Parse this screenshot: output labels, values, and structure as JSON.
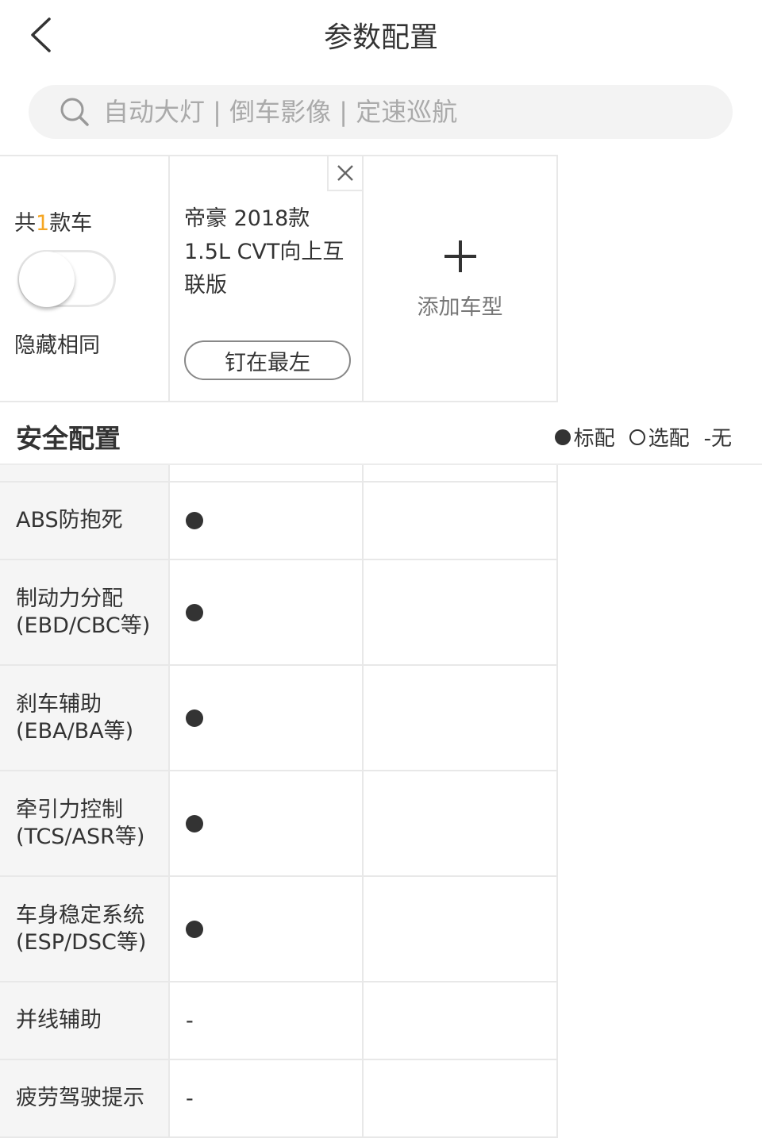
{
  "header": {
    "title": "参数配置"
  },
  "search": {
    "placeholder": "自动大灯 | 倒车影像 | 定速巡航"
  },
  "cars": {
    "count_prefix": "共",
    "count": "1",
    "count_suffix": "款车",
    "hide_same_label": "隐藏相同",
    "hide_same_enabled": false,
    "items": [
      {
        "name": "帝豪 2018款 1.5L CVT向上互联版",
        "pin_label": "钉在最左"
      }
    ],
    "add_label": "添加车型"
  },
  "section": {
    "title": "安全配置",
    "legend": {
      "standard": "标配",
      "optional": "选配",
      "none": "-无"
    }
  },
  "rows": [
    {
      "label": "ABS防抱死",
      "value": "●"
    },
    {
      "label": "制动力分配(EBD/CBC等)",
      "value": "●"
    },
    {
      "label": "刹车辅助(EBA/BA等)",
      "value": "●"
    },
    {
      "label": "牵引力控制(TCS/ASR等)",
      "value": "●"
    },
    {
      "label": "车身稳定系统(ESP/DSC等)",
      "value": "●"
    },
    {
      "label": "并线辅助",
      "value": "-"
    },
    {
      "label": "疲劳驾驶提示",
      "value": "-"
    }
  ]
}
